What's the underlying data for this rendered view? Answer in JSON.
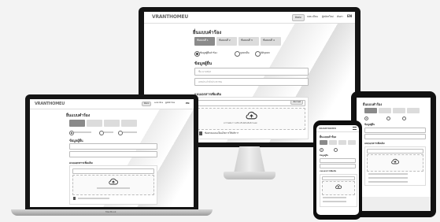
{
  "app": {
    "logo": "VRANTHOMEU",
    "nav": [
      "ติดต่อ",
      "ลงทะเบียน",
      "ผู้สมัครใหม่",
      "ค้นหา",
      "EN"
    ],
    "page_title": "ยื่นแบบคำร้อง",
    "steps": [
      {
        "label": "ขั้นตอนที่ 1"
      },
      {
        "label": "ขั้นตอนที่ 2"
      },
      {
        "label": "ขั้นตอนที่ 3"
      },
      {
        "label": "ขั้นตอนที่ 4"
      }
    ],
    "radio_options": [
      "ข้อมูลผู้ยื่นคำร้อง",
      "บุคคลอื่น",
      "นิติบุคคล"
    ],
    "section_applicant": "ข้อมูลผู้ยื่น",
    "field_name_placeholder": "ชื่อ-นามสกุล",
    "field_id_placeholder": "เลขประจำตัวประชาชน",
    "section_upload": "แนบเอกสารเพิ่มเติม",
    "upload_btn": "เลือกไฟล์",
    "dropzone_text": "ลากไฟล์มาวางที่นี่ หรือคลิกเพื่ออัปโหลด",
    "footer_note": "ข้อตกลงและเงื่อนไขการใช้บริการ",
    "laptop_base_label": "MacBook"
  },
  "icons": [
    "cloud-upload-icon",
    "document-icon",
    "menu-icon"
  ]
}
